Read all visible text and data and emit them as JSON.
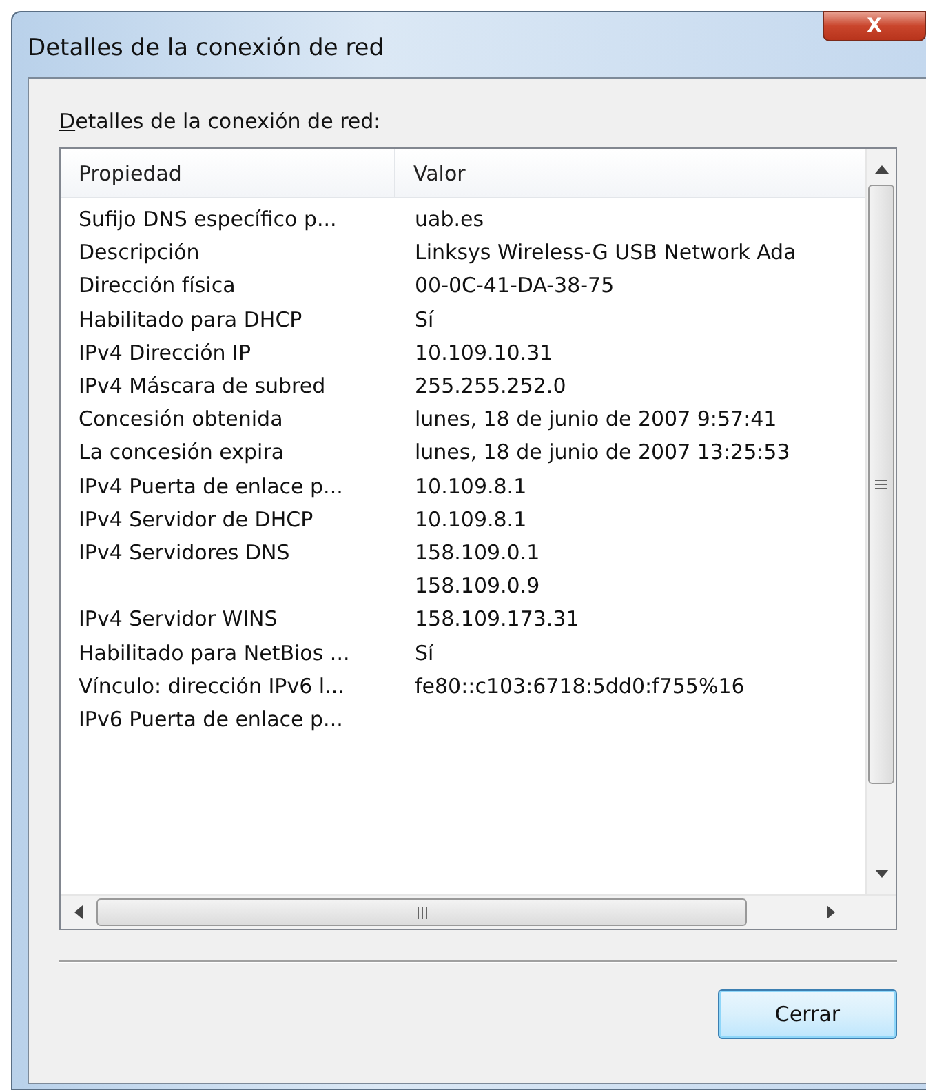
{
  "window": {
    "title": "Detalles de la conexión de red",
    "close_glyph": "X"
  },
  "list_label": "Detalles de la conexión de red:",
  "table": {
    "columns": [
      "Propiedad",
      "Valor"
    ],
    "rows": [
      {
        "property": "Sufijo DNS específico p...",
        "value": "uab.es"
      },
      {
        "property": "Descripción",
        "value": "Linksys Wireless-G USB Network Ada"
      },
      {
        "property": "Dirección física",
        "value": "00-0C-41-DA-38-75"
      },
      {
        "property": "Habilitado para DHCP",
        "value": "Sí"
      },
      {
        "property": "IPv4 Dirección IP",
        "value": "10.109.10.31"
      },
      {
        "property": "IPv4 Máscara de subred",
        "value": "255.255.252.0"
      },
      {
        "property": "Concesión obtenida",
        "value": "lunes, 18 de junio de 2007 9:57:41"
      },
      {
        "property": "La concesión expira",
        "value": "lunes, 18 de junio de 2007 13:25:53"
      },
      {
        "property": "IPv4 Puerta de enlace p...",
        "value": "10.109.8.1"
      },
      {
        "property": "IPv4 Servidor de DHCP",
        "value": "10.109.8.1"
      },
      {
        "property": "IPv4 Servidores DNS",
        "value": "158.109.0.1"
      },
      {
        "value": "158.109.0.9"
      },
      {
        "property": "IPv4 Servidor WINS",
        "value": "158.109.173.31"
      },
      {
        "property": "Habilitado para NetBios ...",
        "value": "Sí"
      },
      {
        "property": "Vínculo: dirección IPv6 l...",
        "value": "fe80::c103:6718:5dd0:f755%16"
      },
      {
        "property": "IPv6 Puerta de enlace p..."
      }
    ]
  },
  "buttons": [
    "Cerrar"
  ]
}
